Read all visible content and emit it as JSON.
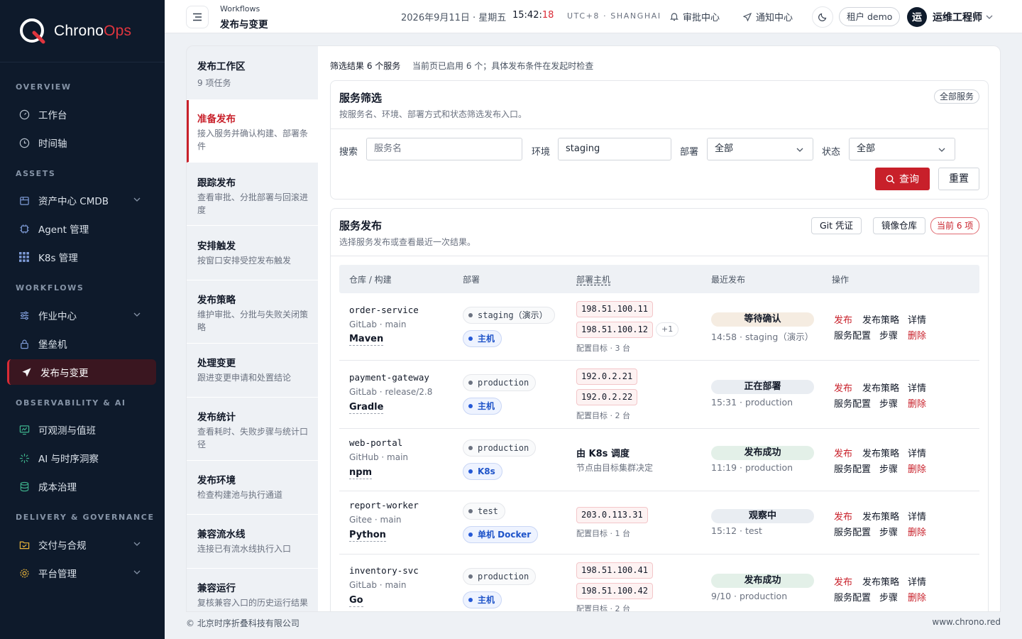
{
  "app": {
    "brand_a": "Chrono",
    "brand_b": "Ops"
  },
  "sidebar": {
    "sections": {
      "overview": "OVERVIEW",
      "assets": "ASSETS",
      "workflows": "WORKFLOWS",
      "observability": "OBSERVABILITY & AI",
      "delivery": "DELIVERY & GOVERNANCE"
    },
    "items": {
      "workbench": "工作台",
      "timeline": "时间轴",
      "cmdb": "资产中心 CMDB",
      "agent": "Agent 管理",
      "k8s": "K8s 管理",
      "jobs": "作业中心",
      "bastion": "堡垒机",
      "release": "发布与变更",
      "observability": "可观测与值班",
      "ai": "AI 与时序洞察",
      "cost": "成本治理",
      "compliance": "交付与合规",
      "platform": "平台管理"
    },
    "accent": "#d92b36"
  },
  "header": {
    "crumb": "Workflows",
    "title": "发布与变更",
    "date": "2026年9月11日 · 星期五",
    "time_hm": "15:42:",
    "time_s": "18",
    "timezone": "UTC+8 · SHANGHAI",
    "approvals": "审批中心",
    "notifications": "通知中心",
    "tenant": "租户 demo",
    "avatar": "运",
    "user": "运维工程师"
  },
  "tasks": [
    {
      "title": "发布工作区",
      "desc": "9 项任务"
    },
    {
      "title": "准备发布",
      "desc": "接入服务并确认构建、部署条件"
    },
    {
      "title": "跟踪发布",
      "desc": "查看审批、分批部署与回滚进度"
    },
    {
      "title": "安排触发",
      "desc": "按窗口安排受控发布触发"
    },
    {
      "title": "发布策略",
      "desc": "维护审批、分批与失败关闭策略"
    },
    {
      "title": "处理变更",
      "desc": "跟进变更申请和处置结论"
    },
    {
      "title": "发布统计",
      "desc": "查看耗时、失败步骤与统计口径"
    },
    {
      "title": "发布环境",
      "desc": "检查构建池与执行通道"
    },
    {
      "title": "兼容流水线",
      "desc": "连接已有流水线执行入口"
    },
    {
      "title": "兼容运行",
      "desc": "复核兼容入口的历史运行结果"
    }
  ],
  "summary": {
    "result": "筛选结果 6 个服务",
    "note": "当前页已启用 6 个；具体发布条件在发起时检查"
  },
  "filter": {
    "title": "服务筛选",
    "subtitle": "按服务名、环境、部署方式和状态筛选发布入口。",
    "badge": "全部服务",
    "search_label": "搜索",
    "search_placeholder": "服务名",
    "env_label": "环境",
    "env_value": "staging",
    "deploy_label": "部署",
    "deploy_value": "全部",
    "status_label": "状态",
    "status_value": "全部",
    "query": "查询",
    "reset": "重置"
  },
  "release": {
    "title": "服务发布",
    "subtitle": "选择服务发布或查看最近一次结果。",
    "git_btn": "Git 凭证",
    "registry_btn": "镜像仓库",
    "count_badge": "当前 6 项",
    "columns": {
      "repo": "仓库 / 构建",
      "deploy": "部署",
      "hosts": "部署主机",
      "recent": "最近发布",
      "ops": "操作"
    },
    "ops": {
      "release": "发布",
      "policy": "发布策略",
      "detail": "详情",
      "config": "服务配置",
      "steps": "步骤",
      "delete": "删除"
    },
    "rows": [
      {
        "name": "order-service",
        "source": "GitLab · main",
        "build": "Maven",
        "env": "staging（演示）",
        "deploy": "主机",
        "ips": [
          "198.51.100.11",
          "198.51.100.12"
        ],
        "more": "+1",
        "hostnote": "配置目标 · 3 台",
        "status": "等待确认",
        "time": "14:58 · staging（演示）"
      },
      {
        "name": "payment-gateway",
        "source": "GitLab · release/2.8",
        "build": "Gradle",
        "env": "production",
        "deploy": "主机",
        "ips": [
          "192.0.2.21",
          "192.0.2.22"
        ],
        "hostnote": "配置目标 · 2 台",
        "status": "正在部署",
        "time": "15:31 · production"
      },
      {
        "name": "web-portal",
        "source": "GitHub · main",
        "build": "npm",
        "env": "production",
        "deploy": "K8s",
        "k8s_title": "由 K8s 调度",
        "k8s_desc": "节点由目标集群决定",
        "status": "发布成功",
        "time": "11:19 · production"
      },
      {
        "name": "report-worker",
        "source": "Gitee · main",
        "build": "Python",
        "env": "test",
        "deploy": "单机 Docker",
        "ips": [
          "203.0.113.31"
        ],
        "hostnote": "配置目标 · 1 台",
        "status": "观察中",
        "time": "15:12 · test"
      },
      {
        "name": "inventory-svc",
        "source": "GitLab · main",
        "build": "Go",
        "env": "production",
        "deploy": "主机",
        "ips": [
          "198.51.100.41",
          "198.51.100.42"
        ],
        "hostnote": "配置目标 · 2 台",
        "status": "发布成功",
        "time": "9/10 · production"
      }
    ]
  },
  "footer": {
    "company": "© 北京时序折叠科技有限公司",
    "site": "www.chrono.red"
  }
}
